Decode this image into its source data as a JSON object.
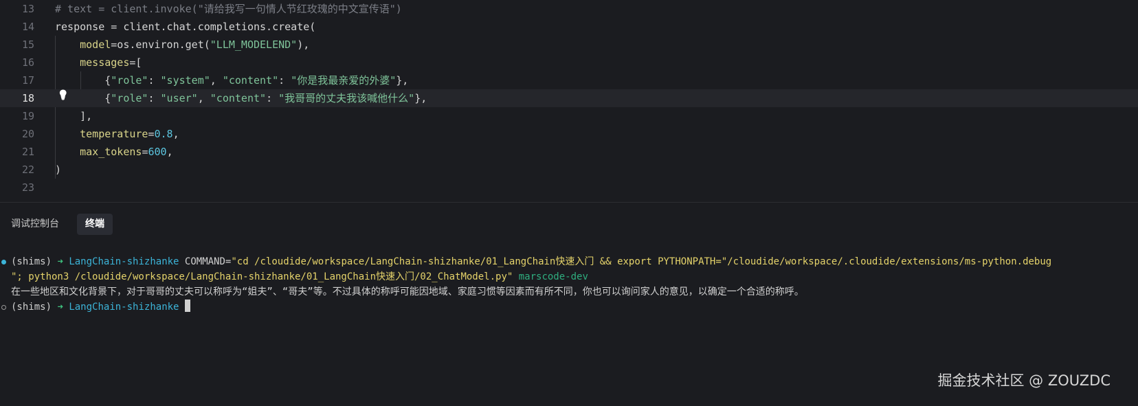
{
  "editor": {
    "active_line": 18,
    "lines": [
      {
        "n": "13",
        "parts": [
          {
            "c": "cm",
            "t": "# text = client.invoke(\"请给我写一句情人节红玫瑰的中文宣传语\")"
          }
        ]
      },
      {
        "n": "14",
        "parts": [
          {
            "c": "kw",
            "t": "response = client.chat.completions.create("
          }
        ]
      },
      {
        "n": "15",
        "parts": [
          {
            "c": "p",
            "t": "    "
          },
          {
            "c": "arg",
            "t": "model"
          },
          {
            "c": "p",
            "t": "=os.environ.get("
          },
          {
            "c": "str",
            "t": "\"LLM_MODELEND\""
          },
          {
            "c": "p",
            "t": "),"
          }
        ]
      },
      {
        "n": "16",
        "parts": [
          {
            "c": "p",
            "t": "    "
          },
          {
            "c": "arg",
            "t": "messages"
          },
          {
            "c": "p",
            "t": "=["
          }
        ]
      },
      {
        "n": "17",
        "parts": [
          {
            "c": "p",
            "t": "        {"
          },
          {
            "c": "str",
            "t": "\"role\""
          },
          {
            "c": "p",
            "t": ": "
          },
          {
            "c": "str",
            "t": "\"system\""
          },
          {
            "c": "p",
            "t": ", "
          },
          {
            "c": "str",
            "t": "\"content\""
          },
          {
            "c": "p",
            "t": ": "
          },
          {
            "c": "str",
            "t": "\"你是我最亲爱的外婆\""
          },
          {
            "c": "p",
            "t": "},"
          }
        ]
      },
      {
        "n": "18",
        "parts": [
          {
            "c": "p",
            "t": "        {"
          },
          {
            "c": "str",
            "t": "\"role\""
          },
          {
            "c": "p",
            "t": ": "
          },
          {
            "c": "str",
            "t": "\"user\""
          },
          {
            "c": "p",
            "t": ", "
          },
          {
            "c": "str",
            "t": "\"content\""
          },
          {
            "c": "p",
            "t": ": "
          },
          {
            "c": "str",
            "t": "\"我哥哥的丈夫我该喊他什么\""
          },
          {
            "c": "p",
            "t": "},"
          }
        ]
      },
      {
        "n": "19",
        "parts": [
          {
            "c": "p",
            "t": "    ],"
          }
        ]
      },
      {
        "n": "20",
        "parts": [
          {
            "c": "p",
            "t": "    "
          },
          {
            "c": "arg",
            "t": "temperature"
          },
          {
            "c": "p",
            "t": "="
          },
          {
            "c": "num",
            "t": "0.8"
          },
          {
            "c": "p",
            "t": ","
          }
        ]
      },
      {
        "n": "21",
        "parts": [
          {
            "c": "p",
            "t": "    "
          },
          {
            "c": "arg",
            "t": "max_tokens"
          },
          {
            "c": "p",
            "t": "="
          },
          {
            "c": "num",
            "t": "600"
          },
          {
            "c": "p",
            "t": ","
          }
        ]
      },
      {
        "n": "22",
        "parts": [
          {
            "c": "p",
            "t": ")"
          }
        ]
      },
      {
        "n": "23",
        "parts": []
      }
    ]
  },
  "panel": {
    "tabs": [
      {
        "label": "调试控制台",
        "selected": false
      },
      {
        "label": "终端",
        "selected": true
      }
    ]
  },
  "terminal": {
    "env": "(shims)",
    "arrow": "➜",
    "dir": "LangChain-shizhanke",
    "cmd_line1": " COMMAND=\"cd /cloudide/workspace/LangChain-shizhanke/01_LangChain快速入门 && export PYTHONPATH=\"/cloudide/workspace/.cloudide/extensions/ms-python.debug",
    "cmd_line2": "\"; python3 /cloudide/workspace/LangChain-shizhanke/01_LangChain快速入门/02_ChatModel.py\"",
    "host": " marscode-dev",
    "output": "在一些地区和文化背景下，对于哥哥的丈夫可以称呼为“姐夫”、“哥夫”等。不过具体的称呼可能因地域、家庭习惯等因素而有所不同，你也可以询问家人的意见，以确定一个合适的称呼。",
    "colors": {
      "done_dot": "#3cb4d8",
      "idle_dot": "#9a9a9a"
    }
  },
  "watermark": "掘金技术社区 @ ZOUZDC"
}
